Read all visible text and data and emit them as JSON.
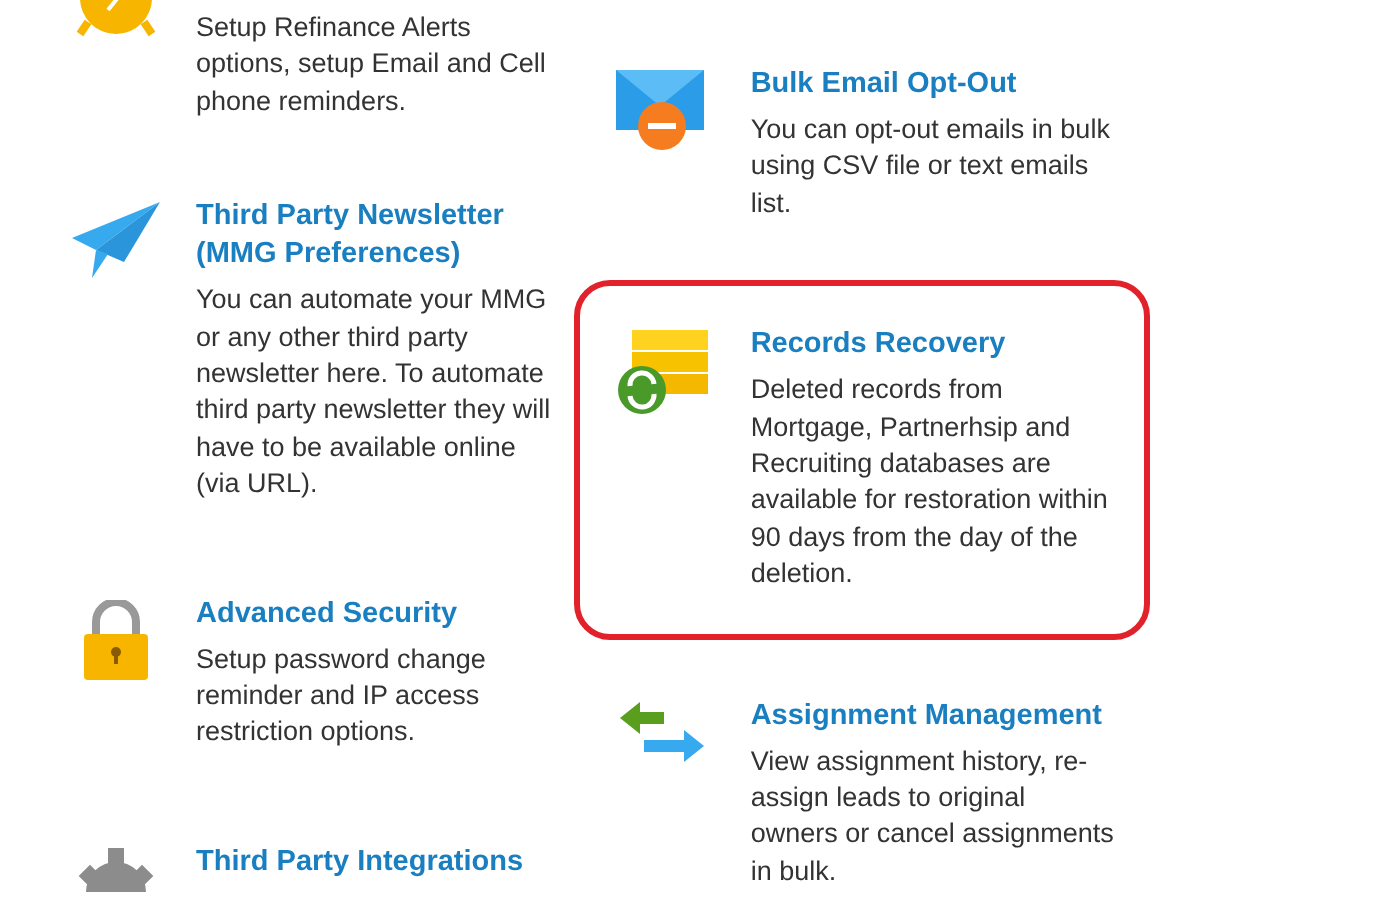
{
  "columns": [
    {
      "items": [
        {
          "kind": "alarm",
          "description": "Setup Refinance Alerts options, setup Email and Cell phone reminders.",
          "highlighted": false
        },
        {
          "kind": "plane",
          "title": "Third Party Newsletter (MMG Preferences)",
          "description": "You can automate your MMG or any other third party newsletter here. To automate third party newsletter they will have to be available online (via URL).",
          "highlighted": false
        },
        {
          "kind": "lock",
          "title": "Advanced Security",
          "description": "Setup password change reminder and IP access restriction options.",
          "highlighted": false
        },
        {
          "kind": "gear",
          "title": "Third Party Integrations",
          "highlighted": false
        }
      ]
    },
    {
      "items": [
        {
          "kind": "mail",
          "title": "Bulk Email Opt-Out",
          "description": "You can opt-out emails in bulk using CSV file or text emails list.",
          "highlighted": false
        },
        {
          "kind": "records",
          "title": "Records Recovery",
          "description": "Deleted records from Mortgage, Partnerhsip and Recruiting databases are available for restoration within 90 days from the day of the deletion.",
          "highlighted": true
        },
        {
          "kind": "arrows",
          "title": "Assignment Management",
          "description": "View assignment history, re-assign leads to original owners or cancel assignments in bulk.",
          "highlighted": false
        }
      ]
    }
  ]
}
